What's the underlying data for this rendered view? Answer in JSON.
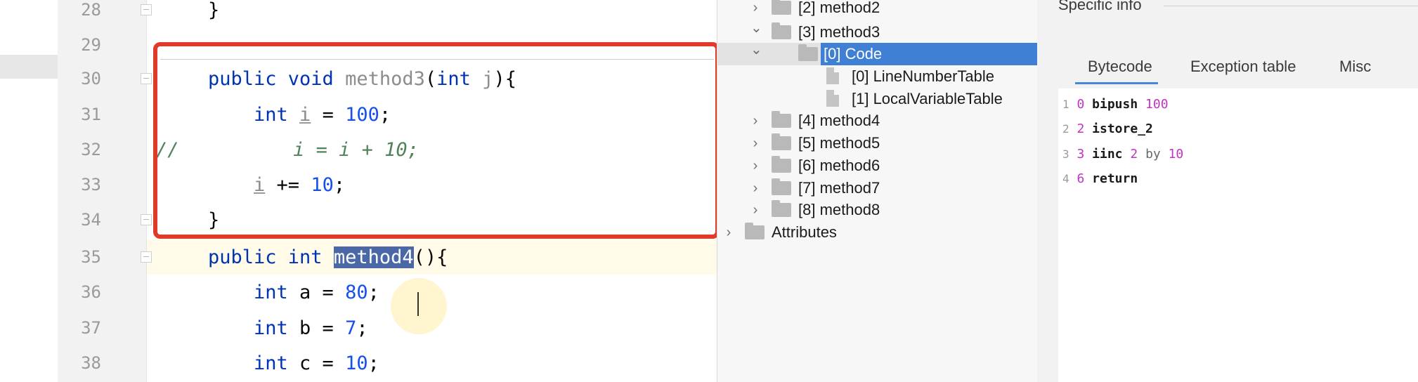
{
  "editor": {
    "lines": [
      {
        "num": "28",
        "parts": [
          {
            "t": "}",
            "c": ""
          }
        ]
      },
      {
        "num": "29",
        "parts": []
      },
      {
        "num": "30",
        "parts": [
          {
            "t": "public void ",
            "c": "kw"
          },
          {
            "t": "method3",
            "c": "dim"
          },
          {
            "t": "(",
            "c": ""
          },
          {
            "t": "int ",
            "c": "kw"
          },
          {
            "t": "j",
            "c": "dim"
          },
          {
            "t": "){",
            "c": ""
          }
        ]
      },
      {
        "num": "31",
        "parts": [
          {
            "t": "    int ",
            "c": "kw"
          },
          {
            "t": "i",
            "c": "var-u"
          },
          {
            "t": " = ",
            "c": ""
          },
          {
            "t": "100",
            "c": "num"
          },
          {
            "t": ";",
            "c": ""
          }
        ]
      },
      {
        "num": "32",
        "parts": [
          {
            "t": "//",
            "c": "comment"
          },
          {
            "t": "          i = i + 10;",
            "c": "comment"
          }
        ]
      },
      {
        "num": "33",
        "parts": [
          {
            "t": "    ",
            "c": ""
          },
          {
            "t": "i",
            "c": "var-u"
          },
          {
            "t": " += ",
            "c": ""
          },
          {
            "t": "10",
            "c": "num"
          },
          {
            "t": ";",
            "c": ""
          }
        ]
      },
      {
        "num": "34",
        "parts": [
          {
            "t": "}",
            "c": ""
          }
        ]
      },
      {
        "num": "35",
        "parts": [
          {
            "t": "public int ",
            "c": "kw"
          },
          {
            "t": "method4",
            "c": "sel"
          },
          {
            "t": "(){",
            "c": ""
          }
        ]
      },
      {
        "num": "36",
        "parts": [
          {
            "t": "    int ",
            "c": "kw"
          },
          {
            "t": "a = ",
            "c": ""
          },
          {
            "t": "80",
            "c": "num"
          },
          {
            "t": ";",
            "c": ""
          }
        ]
      },
      {
        "num": "37",
        "parts": [
          {
            "t": "    int ",
            "c": "kw"
          },
          {
            "t": "b = ",
            "c": ""
          },
          {
            "t": "7",
            "c": "num"
          },
          {
            "t": ";",
            "c": ""
          }
        ]
      },
      {
        "num": "38",
        "parts": [
          {
            "t": "    int ",
            "c": "kw"
          },
          {
            "t": "c = ",
            "c": ""
          },
          {
            "t": "10",
            "c": "num"
          },
          {
            "t": ";",
            "c": ""
          }
        ]
      }
    ]
  },
  "tree": {
    "items": [
      {
        "label": "[2] method2",
        "state": "collapsed",
        "level": 0,
        "kind": "folder"
      },
      {
        "label": "[3] method3",
        "state": "expanded",
        "level": 0,
        "kind": "folder"
      },
      {
        "label": "[0] Code",
        "state": "expanded",
        "level": 1,
        "kind": "folder",
        "selected": true
      },
      {
        "label": "[0] LineNumberTable",
        "state": "leaf",
        "level": 2,
        "kind": "file"
      },
      {
        "label": "[1] LocalVariableTable",
        "state": "leaf",
        "level": 2,
        "kind": "file"
      },
      {
        "label": "[4] method4",
        "state": "collapsed",
        "level": 0,
        "kind": "folder"
      },
      {
        "label": "[5] method5",
        "state": "collapsed",
        "level": 0,
        "kind": "folder"
      },
      {
        "label": "[6] method6",
        "state": "collapsed",
        "level": 0,
        "kind": "folder"
      },
      {
        "label": "[7] method7",
        "state": "collapsed",
        "level": 0,
        "kind": "folder"
      },
      {
        "label": "[8] method8",
        "state": "collapsed",
        "level": 0,
        "kind": "folder"
      },
      {
        "label": "Attributes",
        "state": "collapsed",
        "level": -1,
        "kind": "folder"
      }
    ]
  },
  "info": {
    "title": "Specific info",
    "tabs": [
      "Bytecode",
      "Exception table",
      "Misc"
    ],
    "active_tab": "Bytecode",
    "bytecode": [
      {
        "line": "1",
        "offset": "0",
        "op": "bipush",
        "args": [
          {
            "t": "100",
            "c": "arg"
          }
        ]
      },
      {
        "line": "2",
        "offset": "2",
        "op": "istore_2",
        "args": []
      },
      {
        "line": "3",
        "offset": "3",
        "op": "iinc",
        "args": [
          {
            "t": "2",
            "c": "arg"
          },
          {
            "t": "by",
            "c": "kw"
          },
          {
            "t": "10",
            "c": "arg"
          }
        ]
      },
      {
        "line": "4",
        "offset": "6",
        "op": "return",
        "args": []
      }
    ]
  },
  "colors": {
    "highlight_box": "#e03a2a",
    "selection": "#3f7fd4",
    "keyword": "#0033b3",
    "number": "#1750eb"
  }
}
